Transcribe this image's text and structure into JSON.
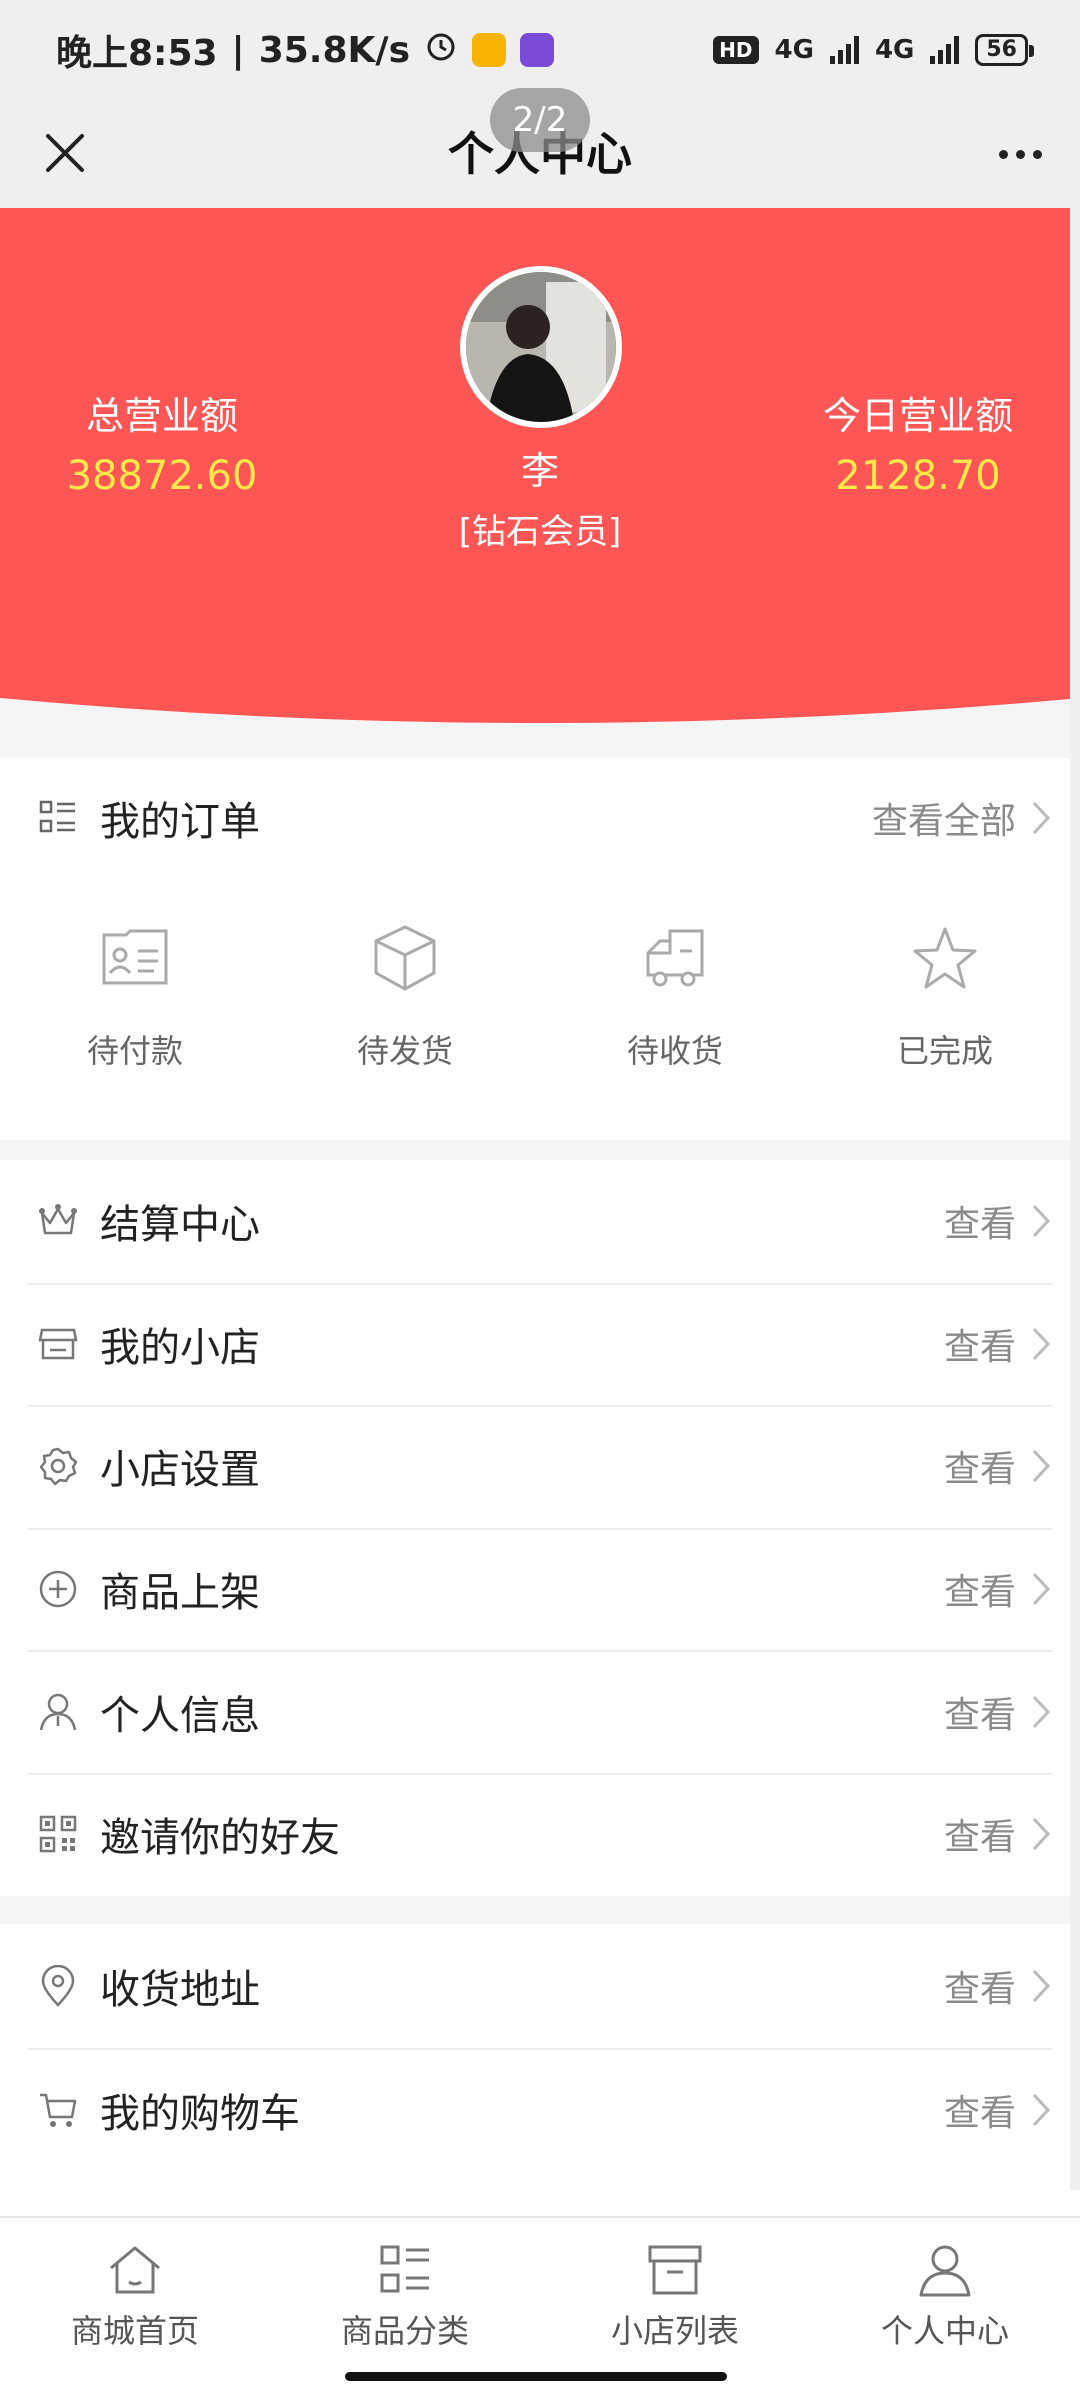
{
  "status_bar": {
    "time": "晚上8:53",
    "net_speed": "35.8K/s",
    "hd": "HD",
    "network1": "4G",
    "network2": "4G",
    "battery": "56"
  },
  "nav": {
    "title": "个人中心",
    "page_indicator": "2/2"
  },
  "profile": {
    "name": "李",
    "level": "[钻石会员]",
    "total_revenue_label": "总营业额",
    "total_revenue_value": "38872.60",
    "today_revenue_label": "今日营业额",
    "today_revenue_value": "2128.70"
  },
  "orders": {
    "title": "我的订单",
    "view_all": "查看全部",
    "items": [
      {
        "label": "待付款",
        "icon": "card-icon"
      },
      {
        "label": "待发货",
        "icon": "box-icon"
      },
      {
        "label": "待收货",
        "icon": "truck-icon"
      },
      {
        "label": "已完成",
        "icon": "star-icon"
      }
    ]
  },
  "menu": [
    {
      "label": "结算中心",
      "action": "查看",
      "icon": "crown-icon"
    },
    {
      "label": "我的小店",
      "action": "查看",
      "icon": "shop-icon"
    },
    {
      "label": "小店设置",
      "action": "查看",
      "icon": "gear-icon"
    },
    {
      "label": "商品上架",
      "action": "查看",
      "icon": "plus-circle-icon"
    },
    {
      "label": "个人信息",
      "action": "查看",
      "icon": "user-icon"
    },
    {
      "label": "邀请你的好友",
      "action": "查看",
      "icon": "qr-code-icon"
    }
  ],
  "menu2": [
    {
      "label": "收货地址",
      "action": "查看",
      "icon": "location-icon"
    },
    {
      "label": "我的购物车",
      "action": "查看",
      "icon": "cart-icon"
    }
  ],
  "tabs": [
    {
      "label": "商城首页",
      "icon": "home-icon"
    },
    {
      "label": "商品分类",
      "icon": "category-icon"
    },
    {
      "label": "小店列表",
      "icon": "store-list-icon"
    },
    {
      "label": "个人中心",
      "icon": "profile-icon"
    }
  ],
  "colors": {
    "header_red": "#fe5555",
    "value_yellow": "#ffe94a",
    "background": "#f5f5f5"
  }
}
